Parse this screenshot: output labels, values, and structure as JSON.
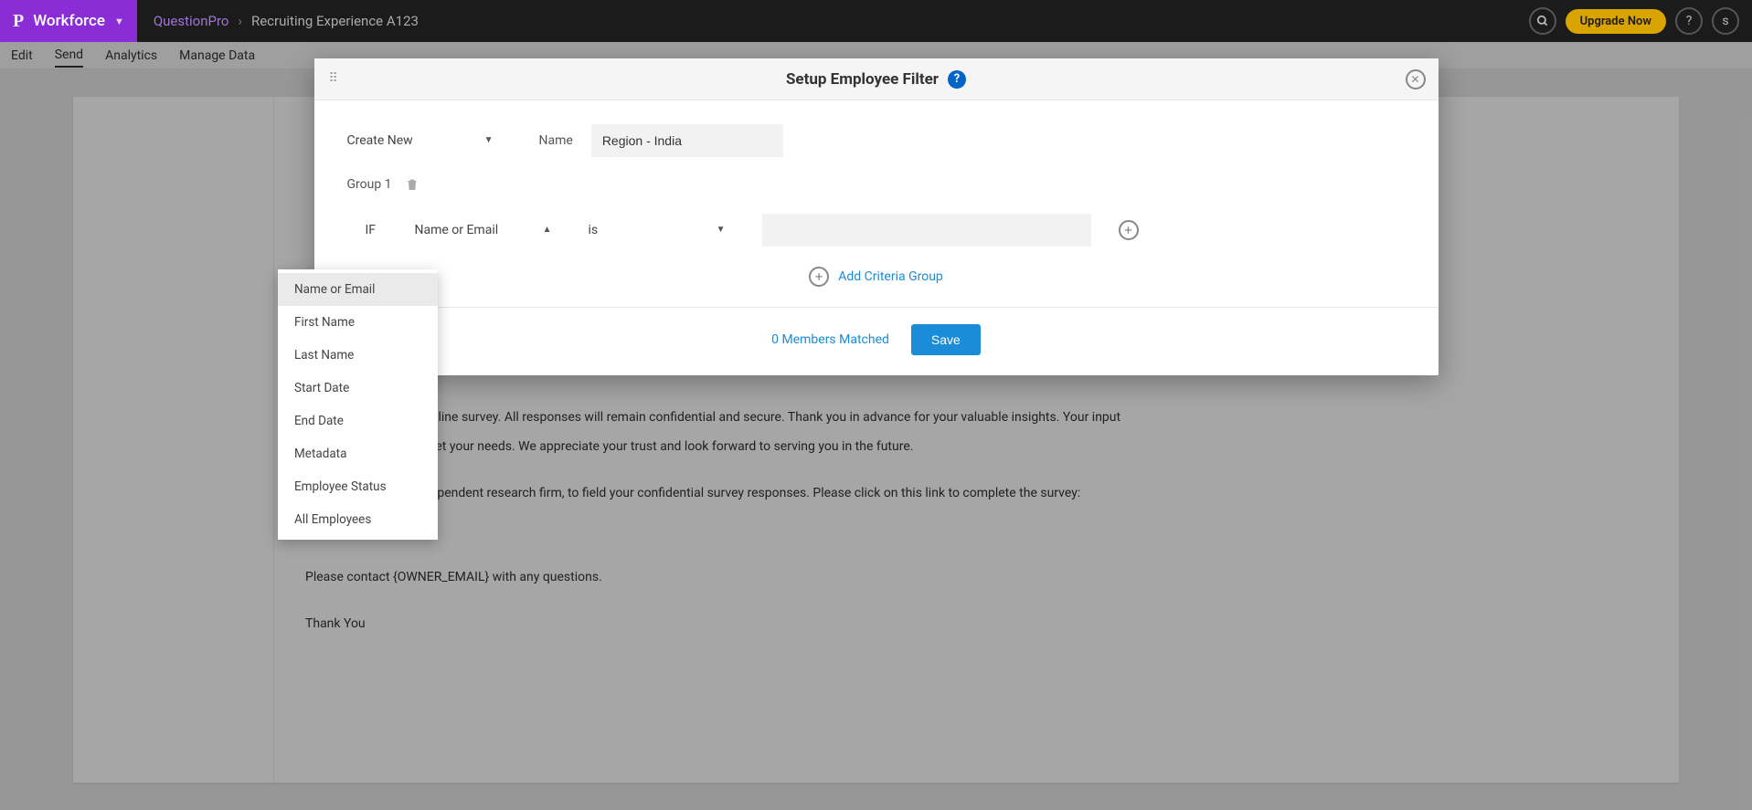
{
  "topbar": {
    "brand": "Workforce",
    "crumb_root": "QuestionPro",
    "crumb_current": "Recruiting Experience A123",
    "upgrade": "Upgrade Now",
    "user_initial": "s"
  },
  "subnav": {
    "items": [
      "Edit",
      "Send",
      "Analytics",
      "Manage Data"
    ],
    "active_index": 1
  },
  "page_body": {
    "p1": "your feedback in our online survey. All responses will remain confidential and secure. Thank you in advance for your valuable insights. Your input",
    "p2": "that we continue to meet your needs. We appreciate your trust and look forward to serving you in the future.",
    "p3": "th QuestionPro, an independent research firm, to field your confidential survey responses. Please click on this link to complete the survey:",
    "p4": "Please contact {OWNER_EMAIL} with any questions.",
    "p5": "Thank You"
  },
  "modal": {
    "title": "Setup Employee Filter",
    "create_select": "Create New",
    "name_label": "Name",
    "name_value": "Region - India",
    "group_label": "Group 1",
    "if_label": "IF",
    "field_select": "Name or Email",
    "op_select": "is",
    "value_input": "",
    "add_group": "Add Criteria Group",
    "members_matched": "0 Members Matched",
    "save": "Save"
  },
  "dropdown": {
    "options": [
      "Name or Email",
      "First Name",
      "Last Name",
      "Start Date",
      "End Date",
      "Metadata",
      "Employee Status",
      "All Employees"
    ],
    "selected_index": 0
  }
}
